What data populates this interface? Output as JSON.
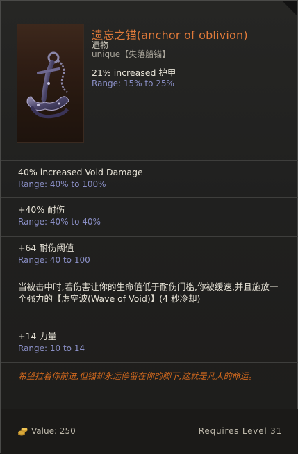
{
  "item": {
    "name": "遗忘之锚(anchor of oblivion)",
    "type": "遗物",
    "rarity": "unique【失落船锚】",
    "implicit": {
      "text": "21% increased 护甲",
      "range": "Range: 15% to 25%"
    },
    "art_icon": "anchor-icon"
  },
  "mods": [
    {
      "text": "40% increased Void Damage",
      "range": "Range: 40% to 100%"
    },
    {
      "text": "+40% 耐伤",
      "range": "Range: 40% to 40%"
    },
    {
      "text": "+64 耐伤阈值",
      "range": "Range: 40 to 100"
    },
    {
      "text": "当被击中时,若伤害让你的生命值低于耐伤门槛,你被缓速,并且施放一个强力的【虚空波(Wave of Void)】(4 秒冷却)"
    },
    {
      "text": "+14 力量",
      "range": "Range: 10 to 14"
    }
  ],
  "lore": "希望拉着你前进,但锚却永远停留在你的脚下,这就是凡人的命运。",
  "footer": {
    "value": "Value: 250",
    "requires": "Requires Level 31",
    "value_icon": "gold-coins-icon"
  },
  "colors": {
    "unique_name": "#e07a3a",
    "range": "#8a8fc6",
    "lore": "#d2691e",
    "text": "#e6e2d6"
  }
}
